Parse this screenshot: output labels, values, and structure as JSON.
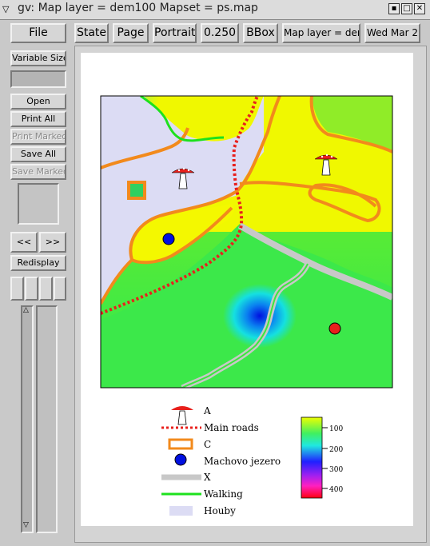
{
  "window": {
    "title": "gv: Map layer = dem100  Mapset = ps.map",
    "controls": [
      "stick",
      "iconify",
      "maximize",
      "close"
    ]
  },
  "toolbar": {
    "file": "File",
    "state": "State",
    "page": "Page",
    "orientation": "Portrait",
    "scale": "0.250",
    "bbox": "BBox",
    "doc_title": "Map layer = dem",
    "date": "Wed Mar 2"
  },
  "sidebar": {
    "variable_size": "Variable Size",
    "open": "Open",
    "print_all": "Print All",
    "print_marked": "Print Marked",
    "save_all": "Save All",
    "save_marked": "Save Marked",
    "prev": "<<",
    "next": ">>",
    "redisplay": "Redisplay"
  },
  "legend": {
    "items": [
      {
        "label": "A",
        "icon": "mushroom-icon"
      },
      {
        "label": "Main roads",
        "icon": "dotted-red-line"
      },
      {
        "label": "C",
        "icon": "orange-square"
      },
      {
        "label": "Machovo jezero",
        "icon": "blue-dot"
      },
      {
        "label": "X",
        "icon": "gray-line"
      },
      {
        "label": "Walking",
        "icon": "green-line"
      },
      {
        "label": "Houby",
        "icon": "lavender-area"
      }
    ],
    "colorbar_ticks": [
      "100",
      "200",
      "300",
      "400"
    ]
  },
  "colors": {
    "road": "#e8201c",
    "boundary": "#f28a1c",
    "walking": "#1de11d",
    "gray_path": "#c8c8c8",
    "houby": "#dcdcf4",
    "lake": "#0010e0"
  }
}
